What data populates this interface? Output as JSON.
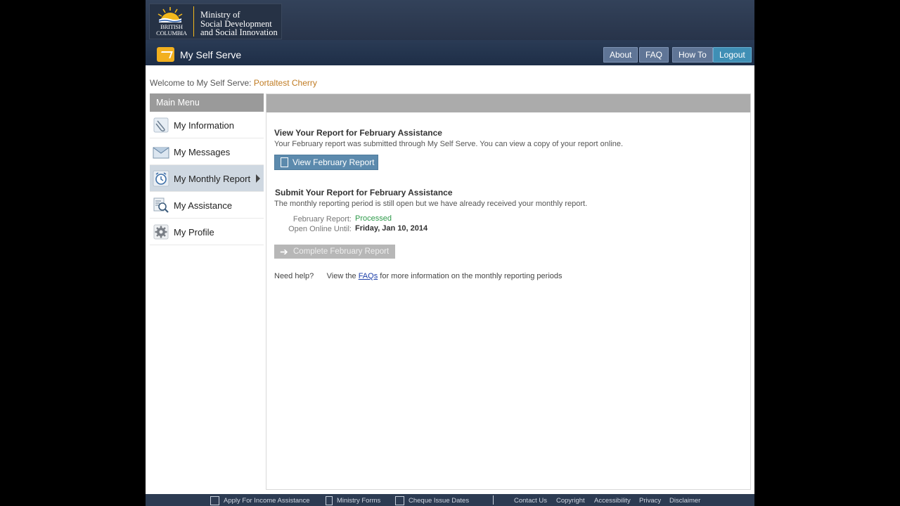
{
  "header": {
    "logo_text_line1": "BRITISH",
    "logo_text_line2": "COLUMBIA",
    "ministry_line1": "Ministry of",
    "ministry_line2": "Social Development",
    "ministry_line3": "and Social Innovation"
  },
  "appbar": {
    "title": "My Self Serve",
    "buttons": [
      "About",
      "FAQ",
      "How To",
      "Logout"
    ]
  },
  "welcome": {
    "prefix": "Welcome to My Self Serve:",
    "user": "Portaltest Cherry"
  },
  "menu": {
    "title": "Main Menu",
    "items": [
      {
        "label": "My Information",
        "icon": "paperclip-icon"
      },
      {
        "label": "My Messages",
        "icon": "envelope-icon"
      },
      {
        "label": "My Monthly Report",
        "icon": "alarm-clock-icon"
      },
      {
        "label": "My Assistance",
        "icon": "magnifier-icon"
      },
      {
        "label": "My Profile",
        "icon": "gear-icon"
      }
    ],
    "active_index": 2
  },
  "content": {
    "view_title": "View Your Report for February Assistance",
    "view_text": "Your February report was submitted through My Self Serve. You can view a copy of your report online.",
    "view_button": "View February Report",
    "submit_title": "Submit Your Report for February Assistance",
    "submit_text": "The monthly reporting period is still open but we have already received your monthly report.",
    "report_label": "February Report:",
    "report_value": "Processed",
    "open_label": "Open Online Until:",
    "open_value": "Friday, Jan 10, 2014",
    "complete_button": "Complete February Report",
    "help_label": "Need help?",
    "help_prefix": "View the",
    "help_link": "FAQs",
    "help_suffix": "for more information on the monthly reporting periods"
  },
  "footer": {
    "links_left": [
      "Apply For Income Assistance",
      "Ministry Forms",
      "Cheque Issue Dates"
    ],
    "links_right": [
      "Contact Us",
      "Copyright",
      "Accessibility",
      "Privacy",
      "Disclaimer"
    ]
  },
  "colors": {
    "header_bg": "#2d3a50",
    "accent_gold": "#f3b81c",
    "processed_green": "#2e9a4a",
    "button_blue": "#5c8aad",
    "logout_blue": "#3f8fb5"
  }
}
